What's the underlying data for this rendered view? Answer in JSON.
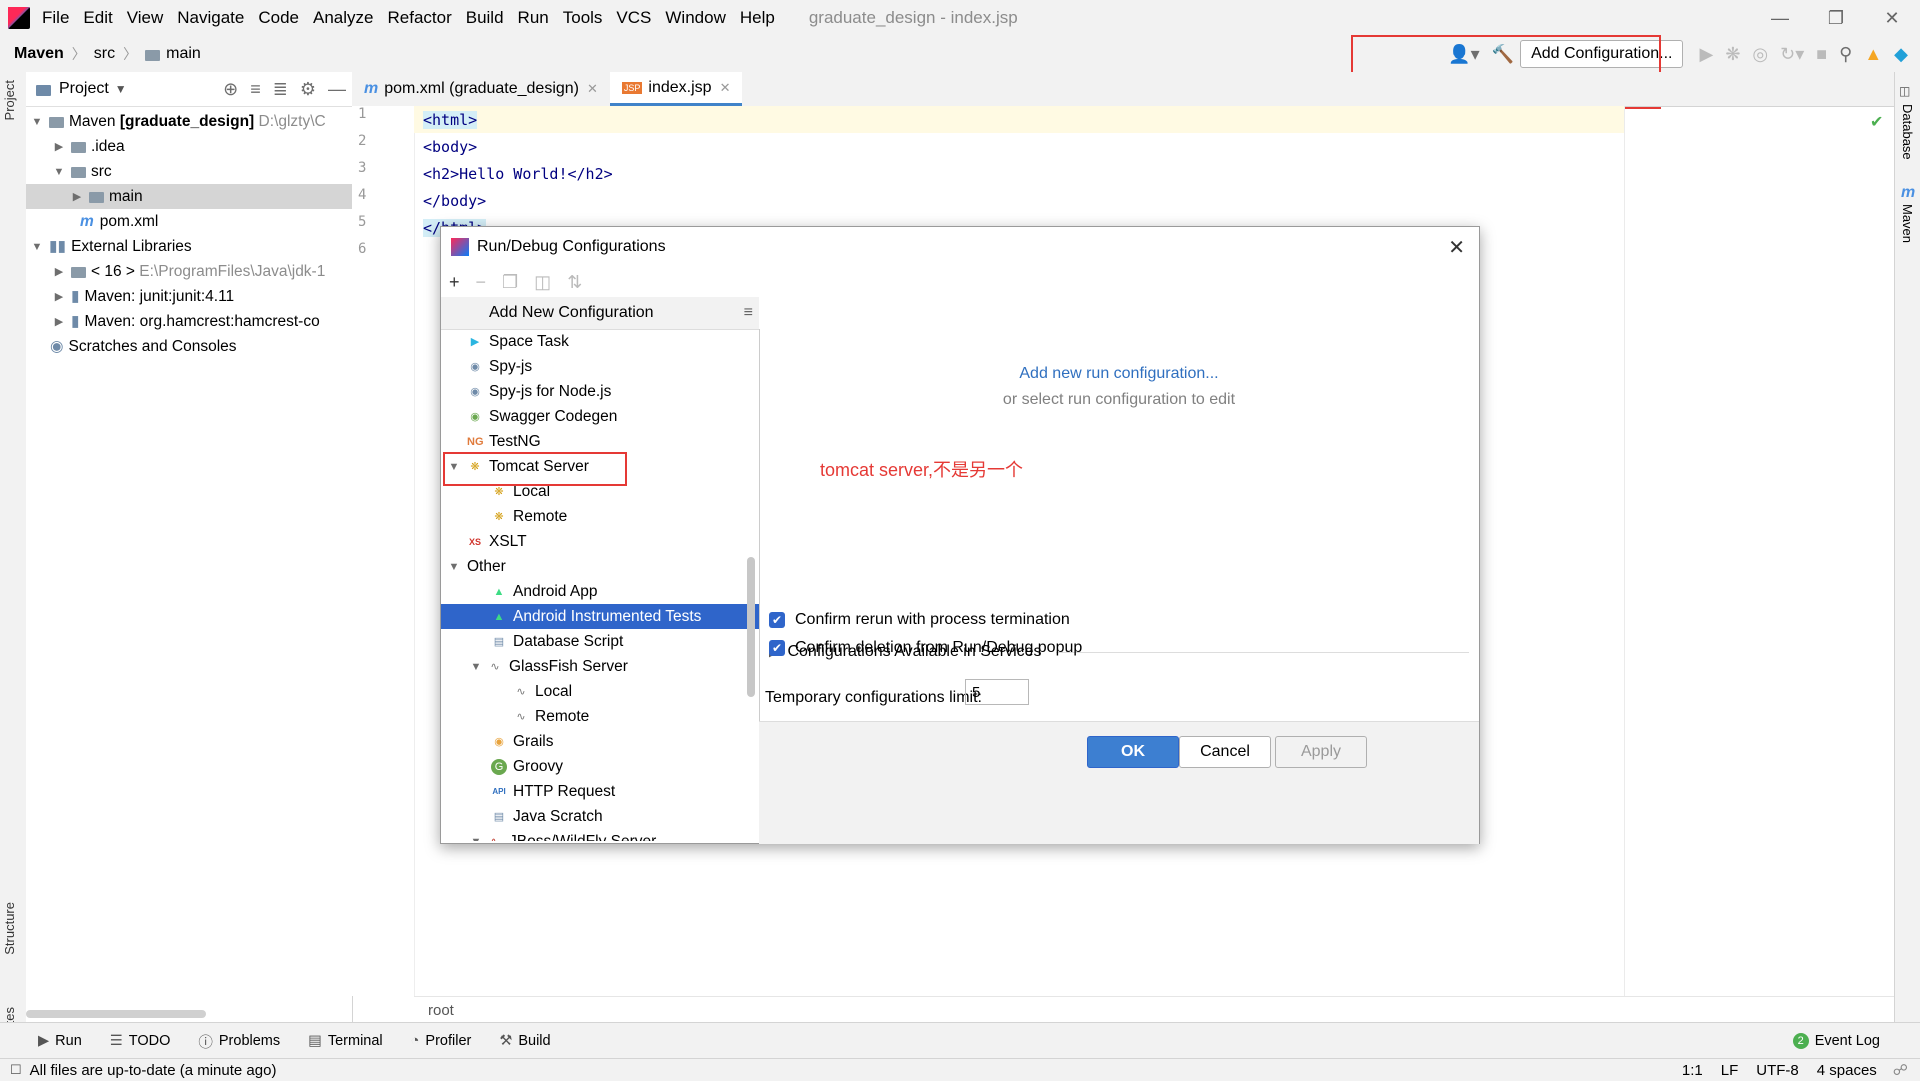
{
  "menubar": {
    "items": [
      "File",
      "Edit",
      "View",
      "Navigate",
      "Code",
      "Analyze",
      "Refactor",
      "Build",
      "Run",
      "Tools",
      "VCS",
      "Window",
      "Help"
    ],
    "window_title": "graduate_design - index.jsp"
  },
  "navbar": {
    "crumbs": [
      "Maven",
      "src",
      "main"
    ],
    "add_configuration": "Add Configuration..."
  },
  "left_strip": {
    "project_tab": "Project",
    "structure_tab": "Structure",
    "favorites_tab": "Favorites"
  },
  "right_strip": {
    "database_tab": "Database",
    "maven_tab": "Maven"
  },
  "project_panel": {
    "header": "Project",
    "tree": [
      {
        "label": "Maven",
        "bold_suffix": "[graduate_design]",
        "muted": "D:\\glzty\\C"
      },
      {
        "label": ".idea"
      },
      {
        "label": "src"
      },
      {
        "label": "main"
      },
      {
        "label": "pom.xml"
      },
      {
        "label": "External Libraries"
      },
      {
        "label": "< 16 >",
        "muted": "E:\\ProgramFiles\\Java\\jdk-1"
      },
      {
        "label": "Maven: junit:junit:4.11"
      },
      {
        "label": "Maven: org.hamcrest:hamcrest-co"
      },
      {
        "label": "Scratches and Consoles"
      }
    ]
  },
  "editor": {
    "tabs": [
      "pom.xml (graduate_design)",
      "index.jsp"
    ],
    "line_numbers": [
      "1",
      "2",
      "3",
      "4",
      "5",
      "6"
    ],
    "lines": [
      "<html>",
      "<body>",
      "<h2>Hello World!</h2>",
      "</body>",
      "</html>",
      ""
    ],
    "breadcrumb": "root"
  },
  "bottom_tools": [
    "Run",
    "TODO",
    "Problems",
    "Terminal",
    "Profiler",
    "Build"
  ],
  "event_log": "Event Log",
  "status": {
    "message": "All files are up-to-date (a minute ago)",
    "position": "1:1",
    "line_sep": "LF",
    "encoding": "UTF-8",
    "indent": "4 spaces"
  },
  "dialog": {
    "title": "Run/Debug Configurations",
    "list_header": "Add New Configuration",
    "items": [
      {
        "label": "Space Task",
        "indent": 1,
        "icon": "space-task-icon"
      },
      {
        "label": "Spy-js",
        "indent": 1,
        "icon": "spy-js-icon"
      },
      {
        "label": "Spy-js for Node.js",
        "indent": 1,
        "icon": "spy-js-icon"
      },
      {
        "label": "Swagger Codegen",
        "indent": 1,
        "icon": "swagger-icon"
      },
      {
        "label": "TestNG",
        "indent": 1,
        "icon": "testng-icon"
      },
      {
        "label": "Tomcat Server",
        "indent": 0,
        "icon": "tomcat-icon",
        "expanded": true
      },
      {
        "label": "Local",
        "indent": 2,
        "icon": "tomcat-icon"
      },
      {
        "label": "Remote",
        "indent": 2,
        "icon": "tomcat-icon"
      },
      {
        "label": "XSLT",
        "indent": 1,
        "icon": "xslt-icon"
      },
      {
        "label": "Other",
        "indent": 0,
        "icon": "",
        "expanded": true
      },
      {
        "label": "Android App",
        "indent": 2,
        "icon": "android-icon"
      },
      {
        "label": "Android Instrumented Tests",
        "indent": 2,
        "icon": "android-icon",
        "selected": true
      },
      {
        "label": "Database Script",
        "indent": 2,
        "icon": "database-icon"
      },
      {
        "label": "GlassFish Server",
        "indent": 1,
        "icon": "glassfish-icon",
        "expanded": true
      },
      {
        "label": "Local",
        "indent": 3,
        "icon": "glassfish-icon"
      },
      {
        "label": "Remote",
        "indent": 3,
        "icon": "glassfish-icon"
      },
      {
        "label": "Grails",
        "indent": 2,
        "icon": "grails-icon"
      },
      {
        "label": "Groovy",
        "indent": 2,
        "icon": "groovy-icon"
      },
      {
        "label": "HTTP Request",
        "indent": 2,
        "icon": "http-icon"
      },
      {
        "label": "Java Scratch",
        "indent": 2,
        "icon": "java-icon"
      },
      {
        "label": "JBoss/WildFly Server",
        "indent": 1,
        "icon": "jboss-icon",
        "expanded": true
      }
    ],
    "add_new_link": "Add new run configuration...",
    "or_select": "or select run configuration to edit",
    "services": "Configurations Available in Services",
    "confirm_rerun": "Confirm rerun with process termination",
    "confirm_deletion": "Confirm deletion from Run/Debug popup",
    "temp_limit_label": "Temporary configurations limit:",
    "temp_limit_value": "5",
    "ok": "OK",
    "cancel": "Cancel",
    "apply": "Apply"
  },
  "annotation": {
    "text": "tomcat server,不是另一个",
    "color": "#e53935"
  },
  "colors": {
    "selection": "#2f65ca",
    "link": "#2f6fbf",
    "accent_tab": "#4083c9"
  }
}
